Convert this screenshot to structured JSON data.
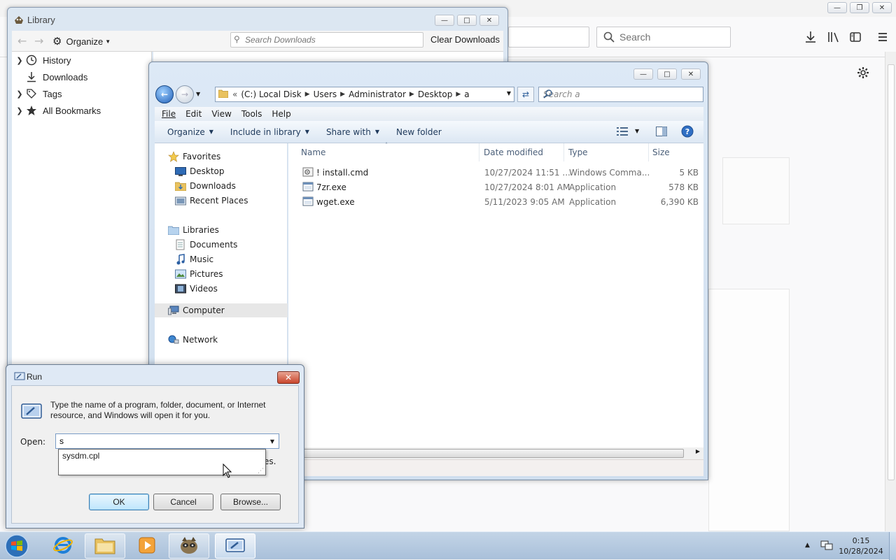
{
  "firefox": {
    "search_placeholder": "Search"
  },
  "library": {
    "title": "Library",
    "organize_label": "Organize",
    "search_placeholder": "Search Downloads",
    "clear_downloads": "Clear Downloads",
    "sidebar": [
      {
        "label": "History",
        "icon": "clock-icon",
        "expandable": true
      },
      {
        "label": "Downloads",
        "icon": "download-icon",
        "expandable": false
      },
      {
        "label": "Tags",
        "icon": "tag-icon",
        "expandable": true
      },
      {
        "label": "All Bookmarks",
        "icon": "star-icon",
        "expandable": true
      }
    ]
  },
  "explorer": {
    "breadcrumbs": [
      "(C:) Local Disk",
      "Users",
      "Administrator",
      "Desktop",
      "a"
    ],
    "search_placeholder": "Search a",
    "menu": [
      "File",
      "Edit",
      "View",
      "Tools",
      "Help"
    ],
    "commands": [
      "Organize",
      "Include in library",
      "Share with",
      "New folder"
    ],
    "nav": {
      "favorites": "Favorites",
      "favorites_items": [
        "Desktop",
        "Downloads",
        "Recent Places"
      ],
      "libraries": "Libraries",
      "libraries_items": [
        "Documents",
        "Music",
        "Pictures",
        "Videos"
      ],
      "computer": "Computer",
      "network": "Network"
    },
    "columns": [
      "Name",
      "Date modified",
      "Type",
      "Size"
    ],
    "files": [
      {
        "name": "! install.cmd",
        "date": "10/27/2024 11:51 ...",
        "type": "Windows Comma...",
        "size": "5 KB"
      },
      {
        "name": "7zr.exe",
        "date": "10/27/2024 8:01 AM",
        "type": "Application",
        "size": "578 KB"
      },
      {
        "name": "wget.exe",
        "date": "5/11/2023 9:05 AM",
        "type": "Application",
        "size": "6,390 KB"
      }
    ]
  },
  "run": {
    "title": "Run",
    "description": "Type the name of a program, folder, document, or Internet resource, and Windows will open it for you.",
    "open_label": "Open:",
    "input_value": "s",
    "suggestion": "sysdm.cpl",
    "partially_hidden_text": "es.",
    "ok": "OK",
    "cancel": "Cancel",
    "browse": "Browse..."
  },
  "taskbar": {
    "time": "0:15",
    "date": "10/28/2024"
  }
}
